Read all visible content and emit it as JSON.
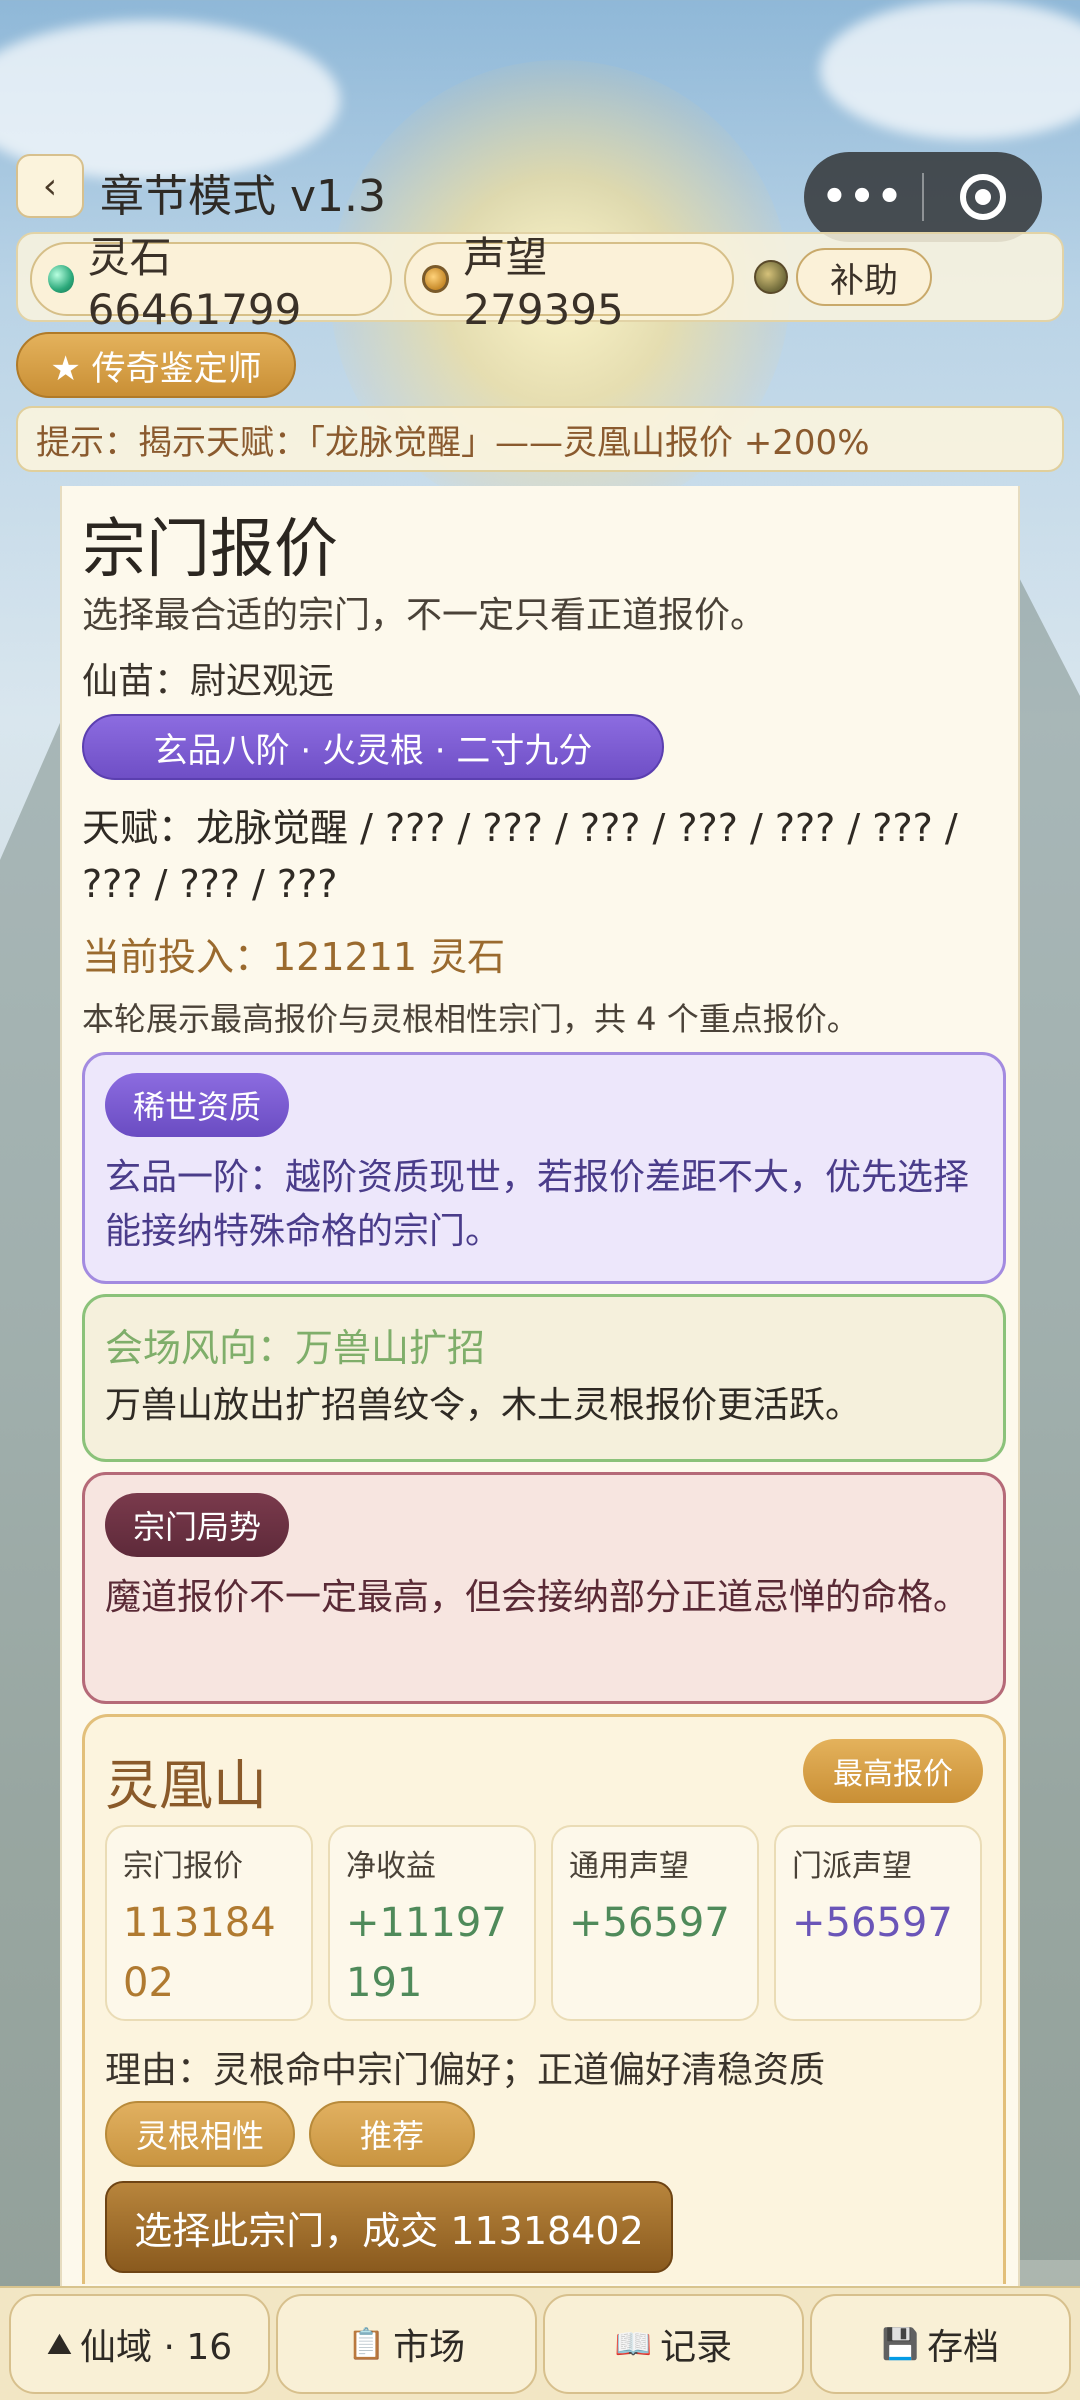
{
  "header": {
    "back_label": "‹",
    "title": "章节模式 v1.3",
    "capsule_more": "•••"
  },
  "resources": {
    "spirit_stone_label": "灵石 66461799",
    "reputation_label": "声望 279395",
    "aid_label": "补助"
  },
  "title_badge": "★ 传奇鉴定师",
  "hint": "提示：揭示天赋：「龙脉觉醒」——灵凰山报价 +200%",
  "panel": {
    "title": "宗门报价",
    "subtitle": "选择最合适的宗门，不一定只看正道报价。",
    "seedling": "仙苗：尉迟观远",
    "grade": "玄品八阶 · 火灵根 · 二寸九分",
    "talents": "天赋：龙脉觉醒 / ??? / ??? / ??? / ??? / ??? / ??? / ??? / ??? / ???",
    "investment": "当前投入：121211 灵石",
    "note": "本轮展示最高报价与灵根相性宗门，共 4 个重点报价。"
  },
  "cards": {
    "rare": {
      "tag": "稀世资质",
      "text": "玄品一阶：越阶资质现世，若报价差距不大，优先选择能接纳特殊命格的宗门。"
    },
    "trend": {
      "title": "会场风向：万兽山扩招",
      "text": "万兽山放出扩招兽纹令，木土灵根报价更活跃。"
    },
    "situation": {
      "tag": "宗门局势",
      "text": "魔道报价不一定最高，但会接纳部分正道忌惮的命格。"
    }
  },
  "sect": {
    "name": "灵凰山",
    "badge": "最高报价",
    "stats": [
      {
        "label": "宗门报价",
        "value": "11318402"
      },
      {
        "label": "净收益",
        "value": "+11197191"
      },
      {
        "label": "通用声望",
        "value": "+56597"
      },
      {
        "label": "门派声望",
        "value": "+56597"
      }
    ],
    "reason": "理由：灵根命中宗门偏好；正道偏好清稳资质",
    "tags": [
      "灵根相性",
      "推荐"
    ],
    "choose_label": "选择此宗门，成交 11318402"
  },
  "nav": [
    {
      "icon": "mountain-icon",
      "glyph": "⛰",
      "label": "仙域 · 16"
    },
    {
      "icon": "clipboard-icon",
      "glyph": "📋",
      "label": "市场"
    },
    {
      "icon": "book-icon",
      "glyph": "📖",
      "label": "记录"
    },
    {
      "icon": "save-icon",
      "glyph": "💾",
      "label": "存档"
    }
  ],
  "colors": {
    "accent_gold": "#c98f35",
    "accent_purple": "#6f4fc6",
    "panel_bg": "#fdf9ec"
  }
}
